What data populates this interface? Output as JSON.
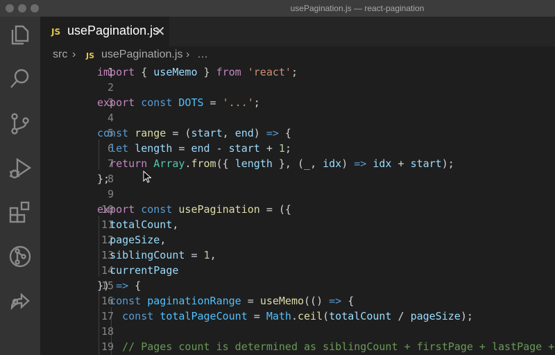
{
  "window": {
    "title": "usePagination.js — react-pagination"
  },
  "activity_bar": {
    "items": [
      "explorer-icon",
      "search-icon",
      "source-control-icon",
      "run-debug-icon",
      "extensions-icon",
      "git-graph-icon",
      "live-share-icon"
    ]
  },
  "tab": {
    "badge": "JS",
    "label": "usePagination.js",
    "close": "✕"
  },
  "breadcrumb": {
    "folder": "src",
    "sep": "›",
    "badge": "JS",
    "file": "usePagination.js",
    "more": "…"
  },
  "editor": {
    "line_numbers": [
      "1",
      "2",
      "3",
      "4",
      "5",
      "6",
      "7",
      "8",
      "9",
      "10",
      "11",
      "12",
      "13",
      "14",
      "15",
      "16",
      "17",
      "18",
      "19"
    ],
    "lines": [
      "import { useMemo } from 'react';",
      "",
      "export const DOTS = '...';",
      "",
      "const range = (start, end) => {",
      "  let length = end - start + 1;",
      "  return Array.from({ length }, (_, idx) => idx + start);",
      "};",
      "",
      "export const usePagination = ({",
      "  totalCount,",
      "  pageSize,",
      "  siblingCount = 1,",
      "  currentPage",
      "}) => {",
      "  const paginationRange = useMemo(() => {",
      "    const totalPageCount = Math.ceil(totalCount / pageSize);",
      "",
      "    // Pages count is determined as siblingCount + firstPage + lastPage + c"
    ]
  },
  "colors": {
    "keyword": "#c586c0",
    "storage": "#569cd6",
    "string": "#ce9178",
    "variable": "#9cdcfe",
    "constant": "#4fc1ff",
    "function": "#dcdcaa",
    "class": "#4ec9b0",
    "number": "#b5cea8",
    "comment": "#6a9955"
  }
}
